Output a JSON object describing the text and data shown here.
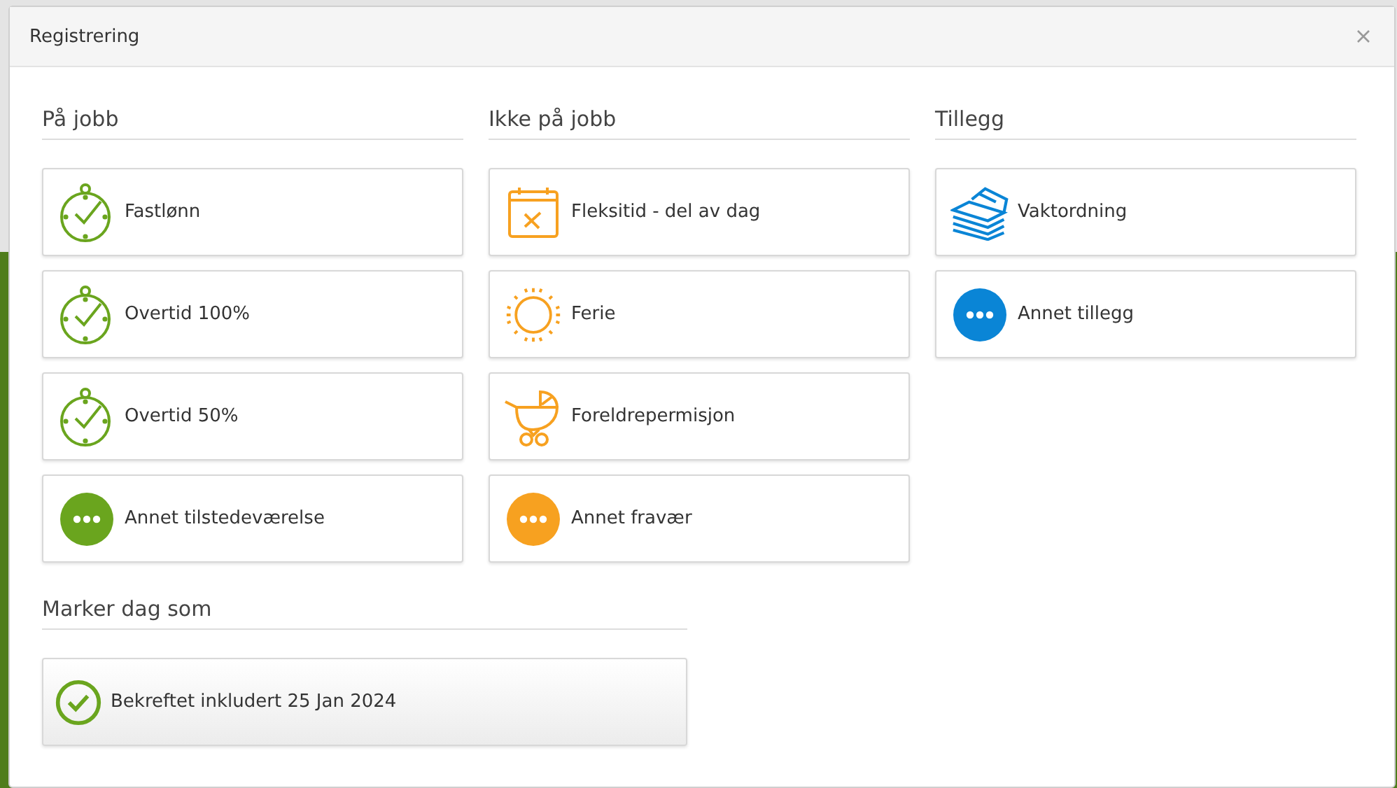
{
  "window": {
    "title": "Registrering"
  },
  "sections": [
    {
      "title": "På jobb",
      "items": [
        {
          "label": "Fastlønn",
          "kind": "stopwatch"
        },
        {
          "label": "Overtid 100%",
          "kind": "stopwatch"
        },
        {
          "label": "Overtid 50%",
          "kind": "stopwatch"
        },
        {
          "label": "Annet tilstedeværelse",
          "kind": "other"
        }
      ]
    },
    {
      "title": "Ikke på jobb",
      "items": [
        {
          "label": "Fleksitid - del av dag",
          "kind": "calendar"
        },
        {
          "label": "Ferie",
          "kind": "sun"
        },
        {
          "label": "Foreldrepermisjon",
          "kind": "stroller"
        },
        {
          "label": "Annet fravær",
          "kind": "other"
        }
      ]
    },
    {
      "title": "Tillegg",
      "items": [
        {
          "label": "Vaktordning",
          "kind": "money"
        },
        {
          "label": "Annet tillegg",
          "kind": "other"
        }
      ]
    }
  ],
  "mark_day": {
    "title": "Marker dag som",
    "button": "Bekreftet inkludert 25 Jan 2024"
  }
}
